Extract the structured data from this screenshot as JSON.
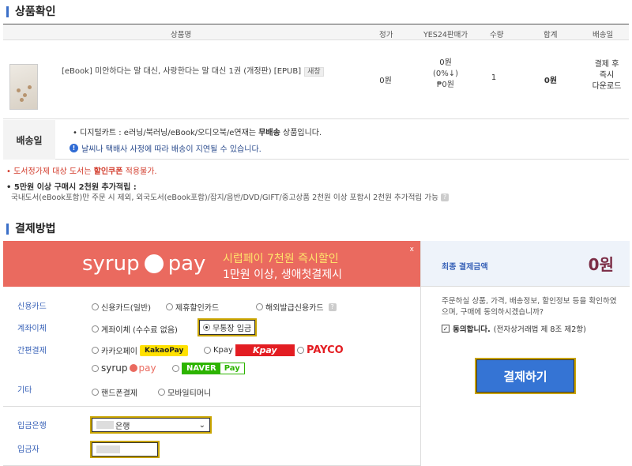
{
  "product_section": {
    "title": "상품확인",
    "columns": [
      "상품명",
      "정가",
      "YES24판매가",
      "수량",
      "합계",
      "배송일"
    ],
    "item": {
      "title": "[eBook] 미안하다는 말 대신, 사랑한다는 말 대신 1권 (개정판) [EPUB]",
      "badge": "새창",
      "list_price": "0원",
      "sale_price": "0원",
      "discount": "(0%↓)",
      "points": "₱0원",
      "quantity": "1",
      "total": "0원",
      "delivery": [
        "결제 후",
        "즉시",
        "다운로드"
      ]
    }
  },
  "shipping": {
    "label": "배송일",
    "line1_prefix": "• 디지털카트 : e러닝/북러닝/eBook/오디오북/e연재는 ",
    "line1_bold": "무배송",
    "line1_suffix": " 상품입니다.",
    "line2": "날씨나 택배사 사정에 따라 배송이 지연될 수 있습니다."
  },
  "notes": {
    "note1_prefix": "• 도서정가제 대상 도서는 ",
    "note1_bold": "할인쿠폰",
    "note1_suffix": " 적용불가.",
    "note2": "• 5만원 이상 구매시 2천원 추가적립 :",
    "note3": "국내도서(eBook포함)만 주문 시 제외, 외국도서(eBook포함)/잡지/음반/DVD/GIFT/중고상품 2천원 이상 포함시 2천원 추가적립 가능"
  },
  "payment_section": {
    "title": "결제방법",
    "banner": {
      "logo_left": "syrup",
      "logo_right": "pay",
      "line1": "시럽페이 7천원 즉시할인",
      "line2": "1만원 이상, 생애첫결제시",
      "close": "x"
    },
    "labels": {
      "credit": "신용카드",
      "transfer": "계좌이체",
      "easy": "간편결제",
      "other": "기타",
      "bank": "입금은행",
      "depositor": "입금자"
    },
    "options": {
      "credit_general": "신용카드(일반)",
      "credit_partner": "제휴할인카드",
      "credit_foreign": "해외발급신용카드",
      "transfer": "계좌이체 (수수료 없음)",
      "deposit": "무통장 입금",
      "kakao": "카카오페이",
      "kakao_logo": "KakaoPay",
      "kpay": "Kpay",
      "kpay_logo": "Kpay",
      "payco": "PAYCO",
      "syrup_logo": "syrup",
      "syrup_pay": "pay",
      "naver_n": "NAVER",
      "naver_pay": "Pay",
      "phone": "핸드폰결제",
      "mobile_money": "모바일티머니"
    },
    "bank_value": "은행"
  },
  "summary": {
    "total_label": "최종 결제금액",
    "total_amount": "0원",
    "agree_text": "주문하실 상품, 가격, 배송정보, 할인정보 등을 확인하였으며, 구매에 동의하시겠습니까?",
    "agree_bold": "동의합니다.",
    "agree_suffix": "(전자상거래법 제 8조 제2항)",
    "pay_button": "결제하기"
  },
  "colors": {
    "accent_blue": "#3574d4",
    "banner_red": "#ea6a5f",
    "highlight": "#c9a400",
    "total_color": "#7b2c45"
  }
}
